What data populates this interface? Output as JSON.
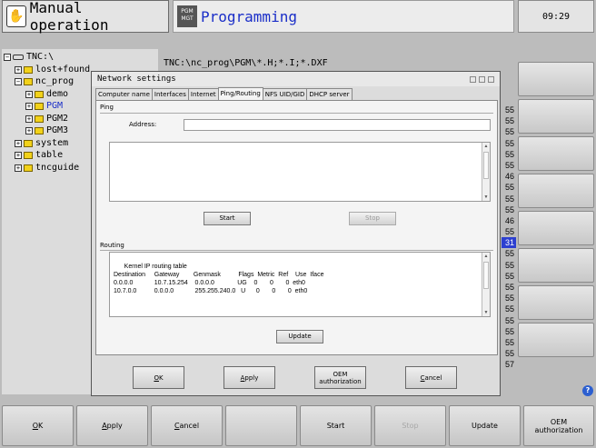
{
  "header": {
    "mode_manual": "Manual operation",
    "pgm_mgt_line1": "PGM",
    "pgm_mgt_line2": "MGT",
    "mode_programming": "Programming",
    "clock": "09:29"
  },
  "file_manager": {
    "path": "TNC:\\nc_prog\\PGM\\*.H;*.I;*.DXF",
    "tree": [
      {
        "label": "TNC:\\",
        "expander": "−",
        "icon": "drive"
      },
      {
        "label": "lost+found",
        "expander": "+",
        "icon": "folder"
      },
      {
        "label": "nc_prog",
        "expander": "−",
        "icon": "folder"
      },
      {
        "label": "demo",
        "expander": "+",
        "icon": "folder"
      },
      {
        "label": "PGM",
        "expander": "+",
        "icon": "folder",
        "selected": true
      },
      {
        "label": "PGM2",
        "expander": "+",
        "icon": "folder"
      },
      {
        "label": "PGM3",
        "expander": "+",
        "icon": "folder"
      },
      {
        "label": "system",
        "expander": "+",
        "icon": "folder"
      },
      {
        "label": "table",
        "expander": "+",
        "icon": "folder"
      },
      {
        "label": "tncguide",
        "expander": "+",
        "icon": "folder"
      }
    ],
    "column_values": [
      "55",
      "55",
      "55",
      "55",
      "55",
      "55",
      "46",
      "55",
      "55",
      "55",
      "46",
      "55",
      "31",
      "55",
      "55",
      "55",
      "55",
      "55",
      "55",
      "55",
      "55",
      "55",
      "55",
      "57"
    ],
    "highlighted_index": 12
  },
  "dialog": {
    "title": "Network settings",
    "tabs": [
      "Computer name",
      "Interfaces",
      "Internet",
      "Ping/Routing",
      "NFS UID/GID",
      "DHCP server"
    ],
    "active_tab": 3,
    "ping": {
      "group_label": "Ping",
      "address_label": "Address:",
      "address_value": "",
      "start_label": "Start",
      "stop_label": "Stop"
    },
    "routing": {
      "group_label": "Routing",
      "table_text": "Kernel IP routing table\nDestination     Gateway        Genmask          Flags  Metric  Ref    Use  Iface\n0.0.0.0            10.7.15.254    0.0.0.0             UG    0       0       0  eth0\n10.7.0.0          0.0.0.0            255.255.240.0   U      0       0       0  eth0",
      "update_label": "Update"
    },
    "buttons": {
      "ok": {
        "accel": "O",
        "rest": "K"
      },
      "apply": {
        "accel": "A",
        "rest": "pply"
      },
      "oem_line1": "OEM",
      "oem_line2": "authorization",
      "cancel": {
        "accel": "C",
        "rest": "ancel"
      }
    }
  },
  "softkeys": {
    "ok": {
      "accel": "O",
      "rest": "K"
    },
    "apply": {
      "accel": "A",
      "rest": "pply"
    },
    "cancel": {
      "accel": "C",
      "rest": "ancel"
    },
    "start": "Start",
    "stop": "Stop",
    "update": "Update",
    "oem_line1": "OEM",
    "oem_line2": "authorization"
  },
  "help_icon": "?"
}
